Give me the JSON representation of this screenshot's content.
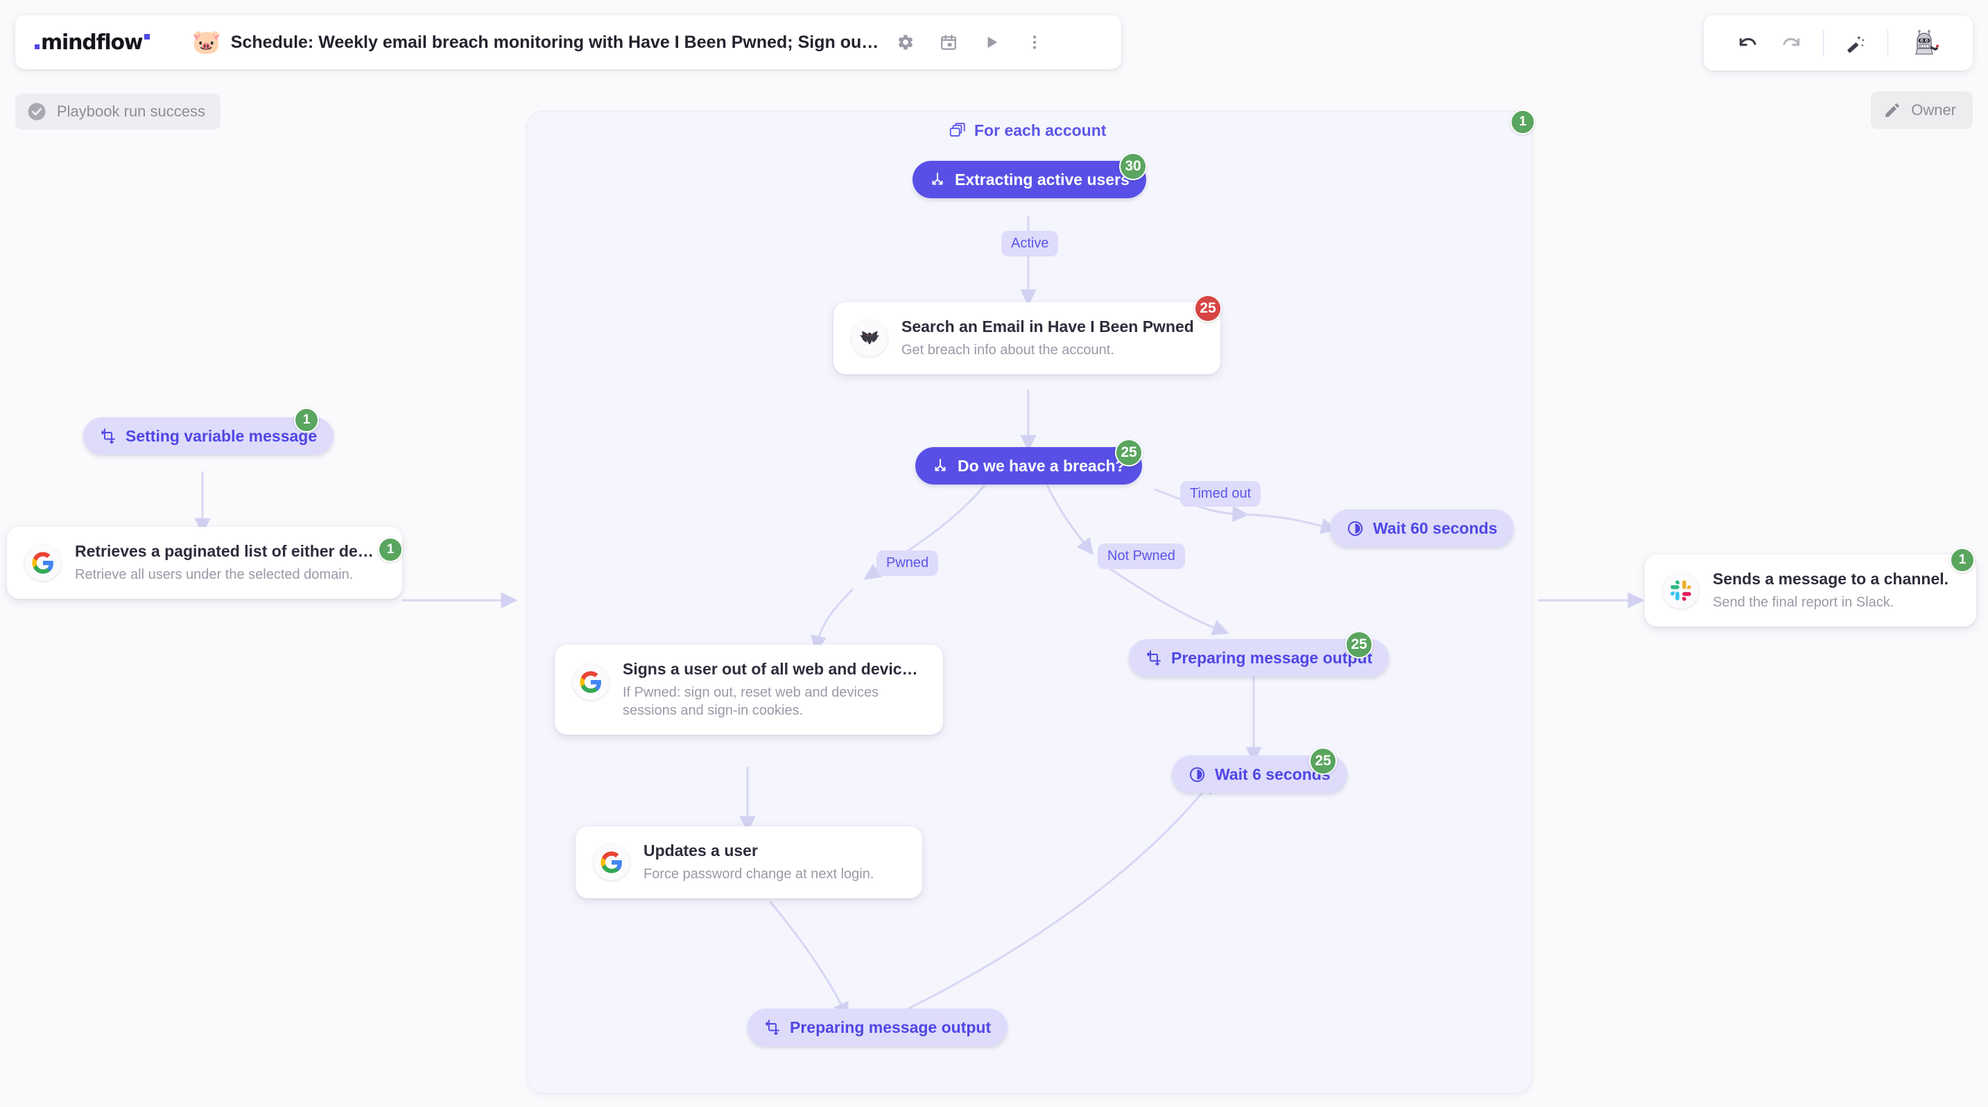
{
  "app": {
    "logo_text": "mindflow",
    "playbook_emoji": "🐷",
    "playbook_title": "Schedule: Weekly email breach monitoring with Have I Been Pwned; Sign ou…",
    "header_icons": [
      {
        "name": "gear-icon",
        "label": "Settings"
      },
      {
        "name": "calendar-icon",
        "label": "Schedule"
      },
      {
        "name": "play-icon",
        "label": "Run"
      },
      {
        "name": "more-vertical-icon",
        "label": "More options"
      }
    ]
  },
  "status": {
    "run_label": "Playbook run success",
    "icon": "check-circle-icon"
  },
  "toolbar": {
    "undo_label": "Undo",
    "redo_label": "Redo",
    "magic_label": "Auto layout",
    "avatar_label": "Bender robot avatar",
    "owner_label": "Owner",
    "owner_icon": "pencil-icon"
  },
  "loop": {
    "label": "For each account",
    "icon": "stacked-cards-icon",
    "badge": "1",
    "badge_color": "#5aa55f"
  },
  "colors": {
    "accent": "#5850e6",
    "accent_soft": "#dedcfa",
    "canvas": "#fafafc",
    "loop_bg": "#f5f5fd",
    "badge_green": "#5aa55f",
    "badge_red": "#d64545"
  },
  "nodes": {
    "setting_variable_message": {
      "label": "Setting variable message",
      "icon": "transform-icon",
      "badge": "1",
      "badge_color": "green",
      "type": "pill-soft"
    },
    "retrieves_paginated_list": {
      "title": "Retrieves a paginated list of either de…",
      "subtitle": "Retrieve all users under the selected domain.",
      "icon": "google-icon",
      "badge": "1",
      "badge_color": "green",
      "type": "card"
    },
    "extracting_active_users": {
      "label": "Extracting active users",
      "icon": "branch-icon",
      "badge": "30",
      "badge_color": "green",
      "type": "pill-solid"
    },
    "search_email_hibp": {
      "title": "Search an Email in Have I Been Pwned",
      "subtitle": "Get breach info about the account.",
      "icon": "hibp-bat-icon",
      "badge": "25",
      "badge_color": "red",
      "type": "card"
    },
    "do_we_have_a_breach": {
      "label": "Do we have a breach?",
      "icon": "branch-icon",
      "badge": "25",
      "badge_color": "green",
      "type": "pill-solid"
    },
    "wait_60_seconds": {
      "label": "Wait 60 seconds",
      "icon": "clock-icon",
      "badge": null,
      "type": "pill-soft"
    },
    "signs_user_out": {
      "title": "Signs a user out of all web and devic…",
      "subtitle": "If Pwned: sign out, reset web and devices sessions and sign-in cookies.",
      "icon": "google-icon",
      "badge": null,
      "type": "card"
    },
    "updates_a_user": {
      "title": "Updates a user",
      "subtitle": "Force password change at next login.",
      "icon": "google-icon",
      "badge": null,
      "type": "card"
    },
    "preparing_message_output_right": {
      "label": "Preparing message output",
      "icon": "transform-icon",
      "badge": "25",
      "badge_color": "green",
      "type": "pill-soft"
    },
    "wait_6_seconds": {
      "label": "Wait 6 seconds",
      "icon": "clock-icon",
      "badge": "25",
      "badge_color": "green",
      "type": "pill-soft"
    },
    "preparing_message_output_bottom": {
      "label": "Preparing message output",
      "icon": "transform-icon",
      "badge": null,
      "type": "pill-soft"
    },
    "sends_message_channel": {
      "title": "Sends a message to a channel.",
      "subtitle": "Send the final report in Slack.",
      "icon": "slack-icon",
      "badge": "1",
      "badge_color": "green",
      "type": "card"
    }
  },
  "edge_labels": {
    "active": "Active",
    "timed_out": "Timed out",
    "pwned": "Pwned",
    "not_pwned": "Not Pwned"
  }
}
